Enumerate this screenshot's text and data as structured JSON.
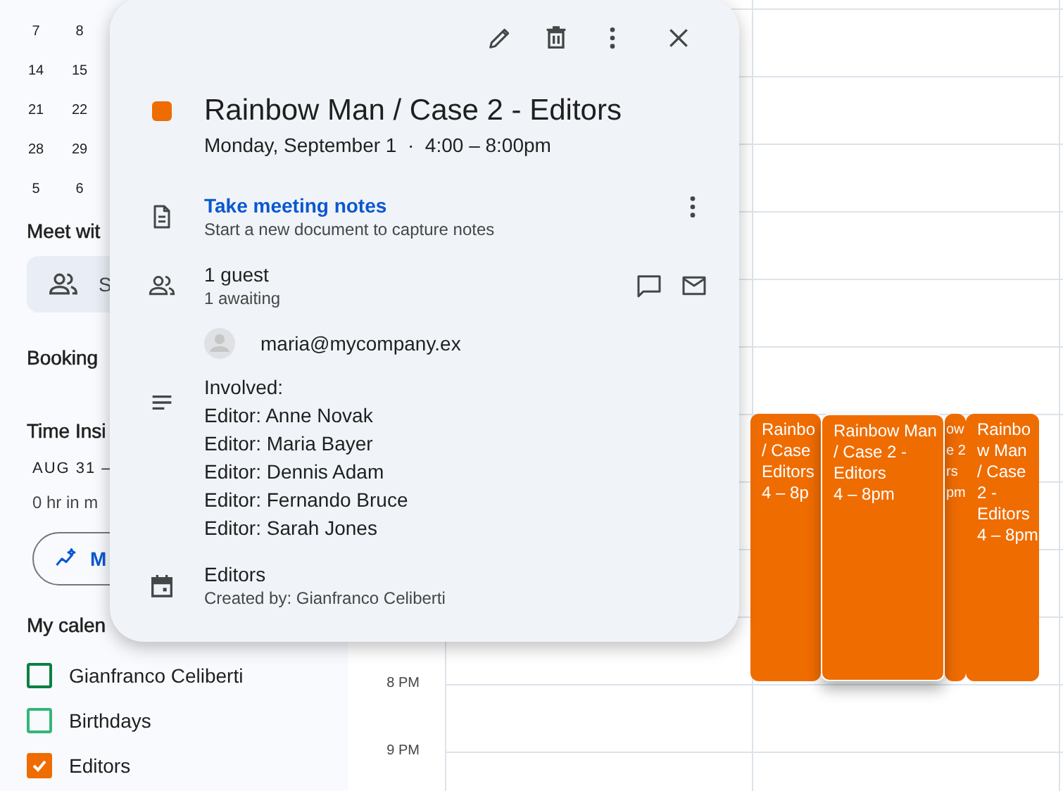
{
  "sidebar": {
    "mini_calendar_rows": [
      [
        "7",
        "8"
      ],
      [
        "14",
        "15"
      ],
      [
        "21",
        "22"
      ],
      [
        "28",
        "29"
      ],
      [
        "5",
        "6"
      ]
    ],
    "meet_with_heading": "Meet wit",
    "search_people_button": "S",
    "booking_heading": "Booking",
    "time_insights_heading": "Time Insi",
    "date_range": "AUG 31 –",
    "meeting_hours": "0 hr in m",
    "more_insights_button": "M",
    "my_calendars_heading": "My calen",
    "calendars": [
      {
        "name": "Gianfranco Celiberti",
        "color": "#0b8043",
        "checked": false
      },
      {
        "name": "Birthdays",
        "color": "#33b679",
        "checked": false
      },
      {
        "name": "Editors",
        "color": "#ef6c00",
        "checked": true
      }
    ]
  },
  "grid": {
    "time_labels": [
      "8 PM",
      "9 PM"
    ],
    "events": [
      {
        "lines": [
          "Rainbo",
          "/ Case",
          "Editors",
          "4 – 8p"
        ],
        "selected": false
      },
      {
        "lines": [
          "Rainbow Man",
          "/ Case 2 -",
          "Editors",
          "4 – 8pm"
        ],
        "selected": true
      },
      {
        "lines": [
          "ow",
          "e 2",
          "rs",
          "pm"
        ],
        "selected": false
      },
      {
        "lines": [
          "Rainbo",
          "w Man",
          "/ Case",
          "2 -",
          "Editors",
          "4 – 8pm"
        ],
        "selected": false
      }
    ]
  },
  "event_popup": {
    "title": "Rainbow Man / Case 2 - Editors",
    "when": "Monday, September 1  ·  4:00 – 8:00pm",
    "notes_link": "Take meeting notes",
    "notes_hint": "Start a new document to capture notes",
    "guest_count": "1 guest",
    "guest_status": "1 awaiting",
    "guests": [
      "maria@mycompany.ex"
    ],
    "description_lines": [
      "Involved:",
      "Editor: Anne Novak",
      "Editor: Maria Bayer",
      "Editor: Dennis Adam",
      "Editor: Fernando Bruce",
      "Editor: Sarah Jones"
    ],
    "calendar_name": "Editors",
    "created_by": "Created by: Gianfranco Celiberti"
  }
}
